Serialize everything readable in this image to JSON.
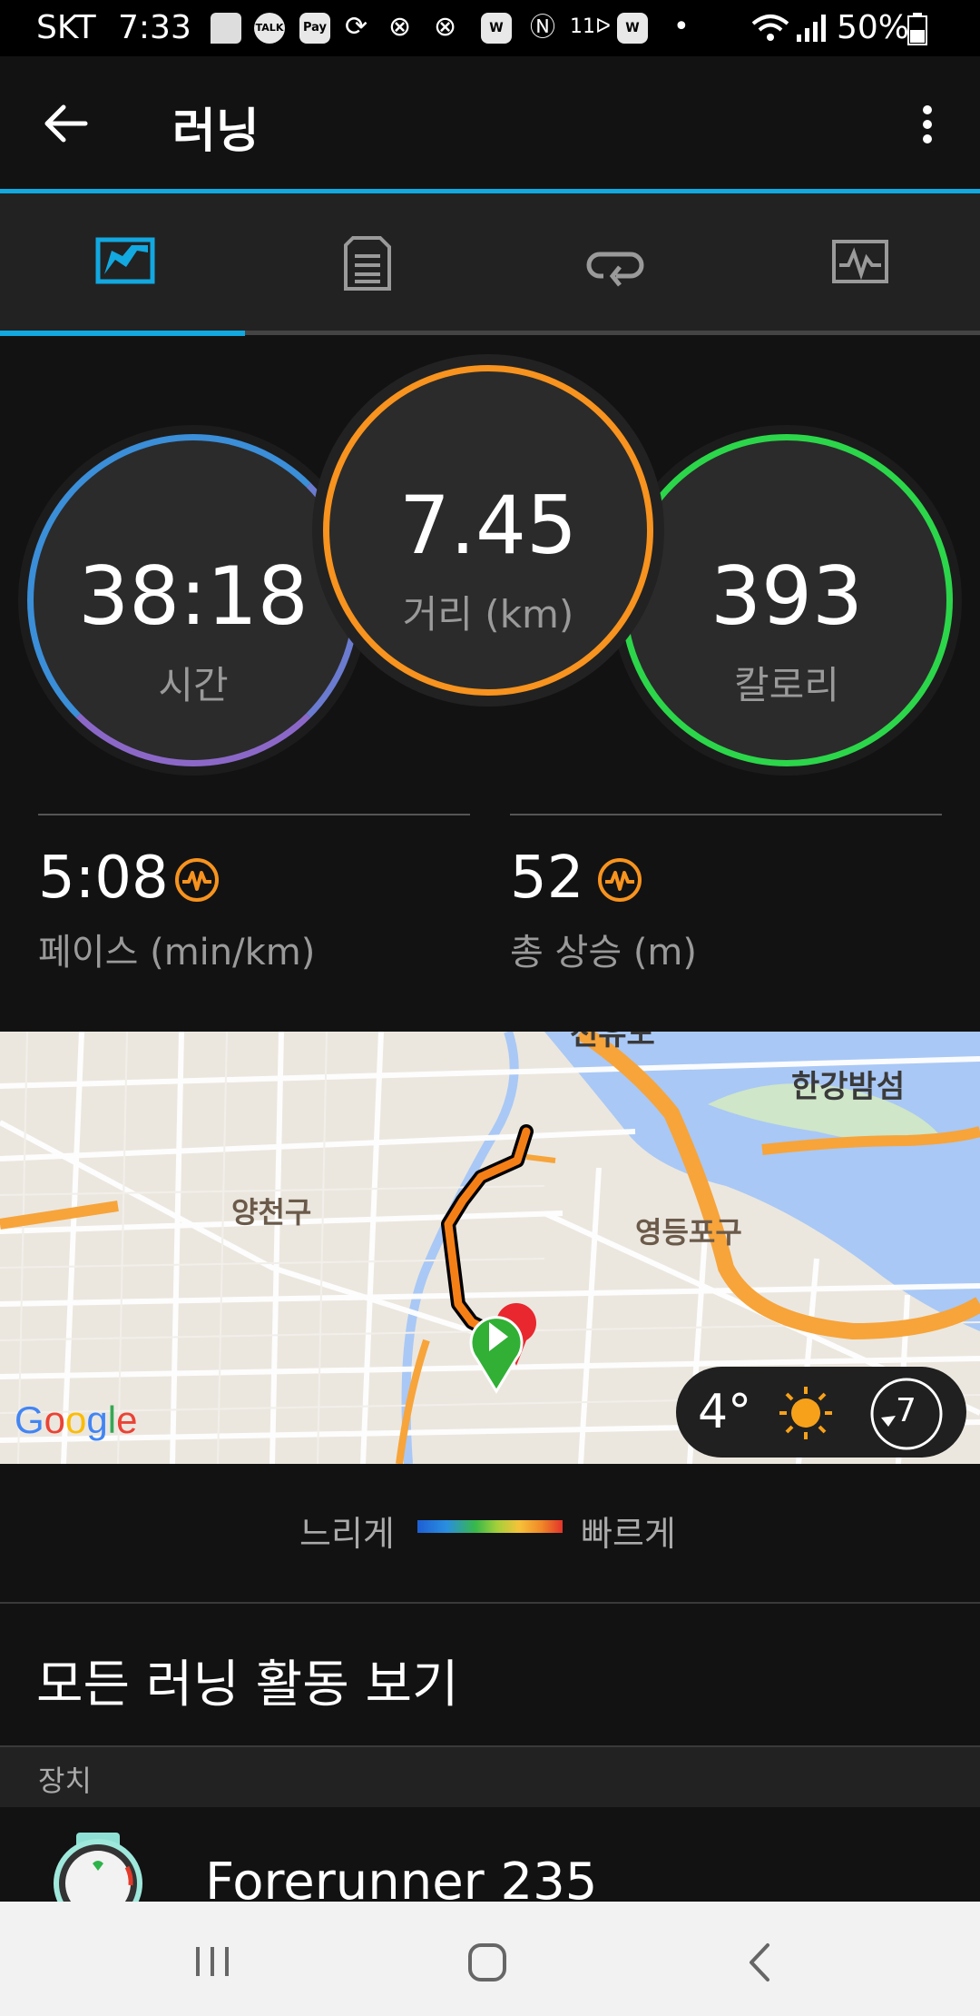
{
  "status_bar": {
    "carrier": "SKT",
    "time": "7:33",
    "battery": "50%",
    "icons": [
      "message-icon",
      "talk-icon",
      "pay-icon",
      "sync-icon",
      "xbox-icon",
      "xbox-icon",
      "w-app-icon",
      "nfc-icon",
      "lte-icon",
      "w-app-icon",
      "dot-icon",
      "wifi-icon",
      "signal-icon",
      "battery-icon"
    ],
    "icon_labels": {
      "talk": "TALK",
      "pay": "Pay",
      "w": "W",
      "lte": "11ᐅ"
    }
  },
  "app_bar": {
    "title": "러닝",
    "back_icon": "back-arrow-icon",
    "menu_icon": "more-vert-icon"
  },
  "tabs": [
    {
      "name": "overview",
      "icon": "map-overview-icon",
      "active": true
    },
    {
      "name": "details",
      "icon": "document-icon",
      "active": false
    },
    {
      "name": "laps",
      "icon": "loop-icon",
      "active": false
    },
    {
      "name": "charts",
      "icon": "chart-icon",
      "active": false
    }
  ],
  "accent_color": "#12a8e0",
  "summary": {
    "time": {
      "value": "38:18",
      "label": "시간"
    },
    "distance": {
      "value": "7.45",
      "label": "거리 (km)"
    },
    "calories": {
      "value": "393",
      "label": "칼로리"
    }
  },
  "ring_colors": {
    "time": [
      "#3b8ed8",
      "#8b68c8"
    ],
    "distance": "#f7931e",
    "calories": "#2cd64a"
  },
  "stats": {
    "pace": {
      "value": "5:08",
      "label": "페이스 (min/km)",
      "icon": "heart-rate-icon"
    },
    "elevation": {
      "value": "52",
      "label": "총 상승 (m)",
      "icon": "heart-rate-icon"
    }
  },
  "map": {
    "labels": [
      "양천구",
      "영등포구",
      "한강밤섬",
      "선유도"
    ],
    "provider": "Google",
    "weather": {
      "temp": "4°",
      "icon": "sun-icon",
      "wind": "7",
      "wind_icon": "wind-compass-icon"
    }
  },
  "speed_legend": {
    "slow": "느리게",
    "fast": "빠르게"
  },
  "all_activities": "모든 러닝 활동 보기",
  "device_section": {
    "header": "장치",
    "device_name": "Forerunner 235",
    "device_icon": "watch-icon"
  },
  "nav_bar": {
    "recent_icon": "recent-apps-icon",
    "home_icon": "home-icon",
    "back_icon": "nav-back-icon"
  }
}
